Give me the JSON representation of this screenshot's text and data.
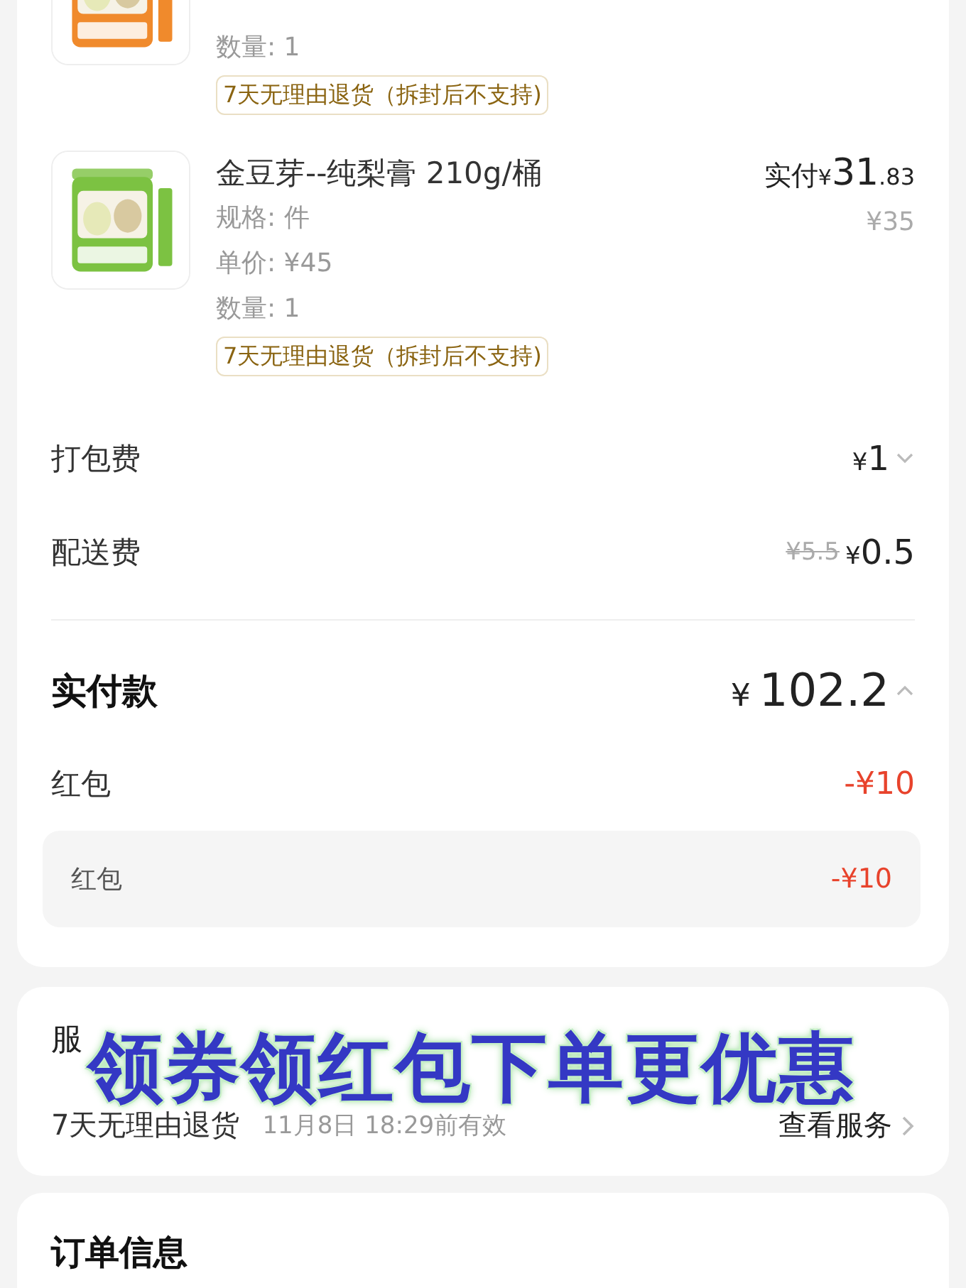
{
  "products": [
    {
      "lines": [
        "数量: 1"
      ],
      "badge": "7天无理由退货（拆封后不支持)"
    },
    {
      "name": "金豆芽--纯梨膏 210g/桶",
      "paid_label": "实付",
      "paid_currency": "¥",
      "paid_whole": "31",
      "paid_fraction": ".83",
      "original_price": "¥35",
      "lines": [
        "规格: 件",
        "单价: ¥45",
        "数量: 1"
      ],
      "badge": "7天无理由退货（拆封后不支持)"
    }
  ],
  "fees": [
    {
      "label": "打包费",
      "currency": "¥",
      "amount": "1",
      "expanded": false
    },
    {
      "label": "配送费",
      "old_price": "¥5.5",
      "currency": "¥",
      "amount": "0.5"
    }
  ],
  "total": {
    "label": "实付款",
    "currency": "¥",
    "amount": "102.2",
    "expanded": true
  },
  "discount": {
    "label": "红包",
    "value": "-¥10"
  },
  "discount_detail": {
    "label": "红包",
    "value": "-¥10"
  },
  "service": {
    "title": "服",
    "name": "7天无理由退货",
    "validity": "11月8日 18:29前有效",
    "link": "查看服务"
  },
  "order_info": {
    "title": "订单信息"
  },
  "overlay_caption": "领券领红包下单更优惠"
}
